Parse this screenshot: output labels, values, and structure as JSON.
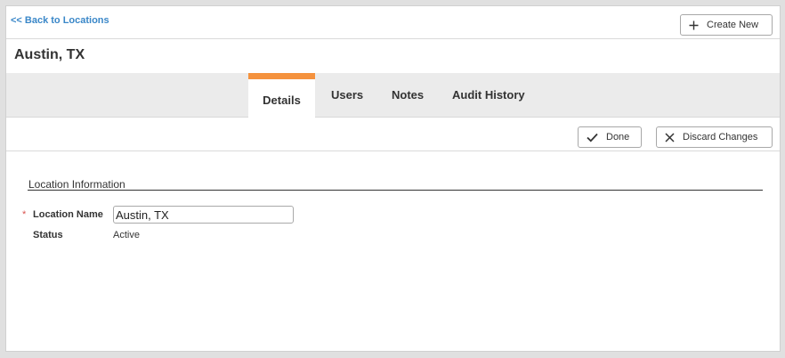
{
  "nav": {
    "back_label": "<< Back to Locations",
    "create_new_label": "Create New"
  },
  "page": {
    "title": "Austin, TX"
  },
  "tabs": [
    {
      "label": "Details",
      "active": true
    },
    {
      "label": "Users",
      "active": false
    },
    {
      "label": "Notes",
      "active": false
    },
    {
      "label": "Audit History",
      "active": false
    }
  ],
  "actions": {
    "done_label": "Done",
    "discard_label": "Discard Changes"
  },
  "form": {
    "section_title": "Location Information",
    "required_marker": "*",
    "name_label": "Location Name",
    "name_value": "Austin, TX",
    "status_label": "Status",
    "status_value": "Active"
  },
  "colors": {
    "link": "#3a87c8",
    "active_tab_accent": "#f5923e",
    "required": "#d9534f"
  },
  "icons": {
    "create": "plus-icon",
    "done": "checkmark-icon",
    "discard": "close-icon"
  }
}
